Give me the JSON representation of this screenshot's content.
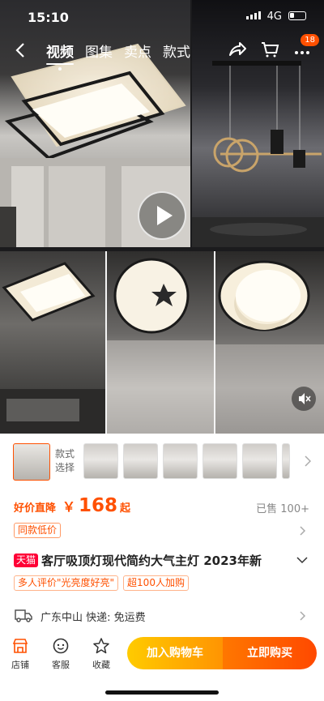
{
  "status_bar": {
    "time": "15:10",
    "network": "4G"
  },
  "nav": {
    "tabs": [
      "视频",
      "图集",
      "卖点",
      "款式"
    ],
    "active_tab": 0,
    "cart_badge": "18"
  },
  "selector": {
    "label": "款式选择",
    "thumb_count": 6
  },
  "price": {
    "promo_label": "好价直降",
    "currency": "￥",
    "amount": "168",
    "suffix": "起",
    "sold": "已售 100+"
  },
  "same_price_tag": "同款低价",
  "product": {
    "brand_tag": "天猫",
    "title": "客厅吸顶灯现代简约大气主灯 2023年新"
  },
  "tags": [
    "多人评价\"光亮度好亮\"",
    "超100人加购"
  ],
  "shipping": {
    "text": "广东中山  快递: 免运费"
  },
  "bottom_bar": {
    "store": "店铺",
    "service": "客服",
    "favorite": "收藏",
    "add_to_cart": "加入购物车",
    "buy_now": "立即购买"
  },
  "colors": {
    "accent": "#ff5000",
    "tmall": "#ff0036"
  }
}
